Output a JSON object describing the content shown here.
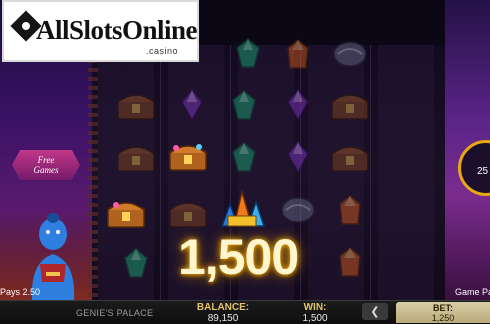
{
  "logo": {
    "brand": "AllSlotsOnline",
    "suffix": ".casino"
  },
  "game": {
    "name": "GENIE'S PALACE"
  },
  "badges": {
    "free_games": "Free Games",
    "pays_left": "Pays 2.50",
    "game_pays_right": "Game Pa",
    "spin_value": "25"
  },
  "win_display": {
    "amount": "1,500"
  },
  "bottom_bar": {
    "balance_label": "BALANCE:",
    "balance_value": "89,150",
    "win_label": "WIN:",
    "win_value": "1,500",
    "bet_label": "BET:",
    "bet_value": "1,250",
    "prev_bet_glyph": "❮"
  },
  "colors": {
    "accent_gold": "#e3c46a",
    "win_glow": "#f5b400",
    "bet_box": "#d8cfa6"
  },
  "symbols": [
    {
      "name": "green-gem-icon",
      "state": "dim"
    },
    {
      "name": "orange-gem-icon",
      "state": "dim"
    },
    {
      "name": "magic-lamp-icon",
      "state": "dim"
    },
    {
      "name": "treasure-chest-icon",
      "state": "dim"
    },
    {
      "name": "purple-gem-icon",
      "state": "dim"
    },
    {
      "name": "green-gem-icon",
      "state": "dim"
    },
    {
      "name": "purple-gem-icon",
      "state": "dim"
    },
    {
      "name": "treasure-chest-icon",
      "state": "dim"
    },
    {
      "name": "treasure-chest-icon",
      "state": "dim"
    },
    {
      "name": "treasure-chest-icon",
      "state": "highlight"
    },
    {
      "name": "green-gem-icon",
      "state": "dim"
    },
    {
      "name": "purple-gem-icon",
      "state": "dim"
    },
    {
      "name": "treasure-chest-icon",
      "state": "dim"
    },
    {
      "name": "treasure-chest-icon",
      "state": "highlight"
    },
    {
      "name": "treasure-chest-icon",
      "state": "dim"
    },
    {
      "name": "gem-pile-icon",
      "state": "highlight"
    },
    {
      "name": "magic-lamp-icon",
      "state": "dim"
    },
    {
      "name": "orange-gem-icon",
      "state": "dim"
    },
    {
      "name": "green-gem-icon",
      "state": "dim"
    },
    {
      "name": "orange-gem-icon",
      "state": "dim"
    }
  ]
}
